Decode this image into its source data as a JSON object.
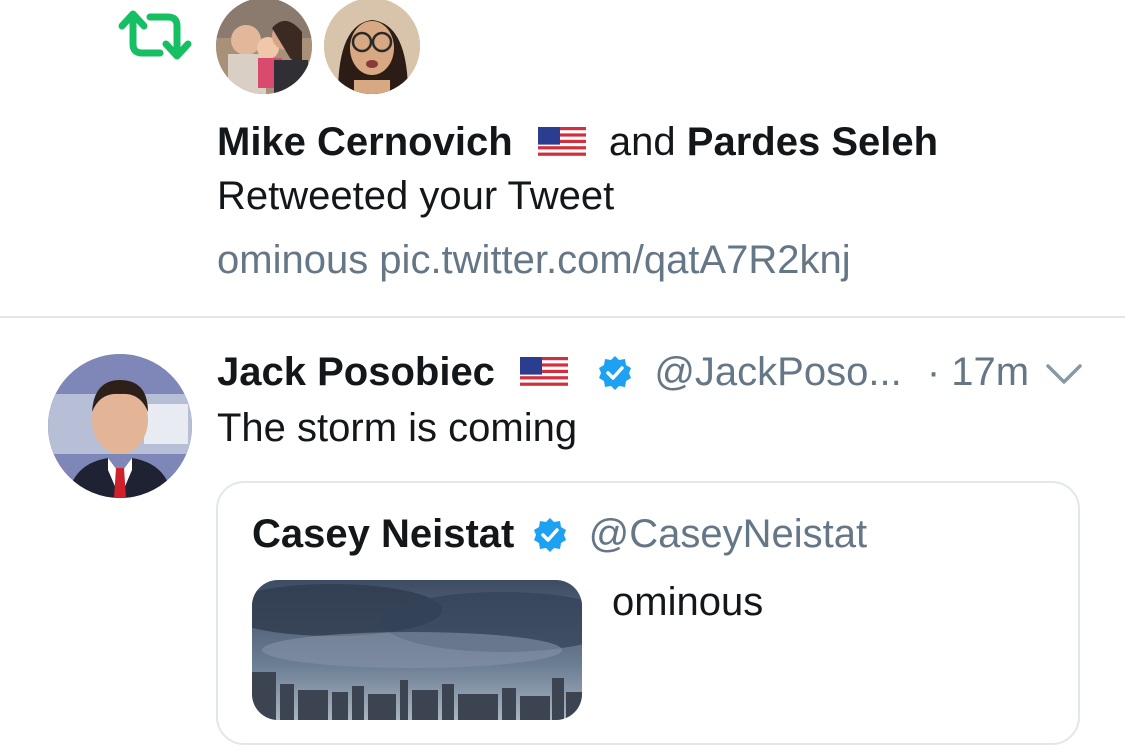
{
  "notification": {
    "user1": "Mike Cernovich",
    "connector": "and",
    "user2": "Pardes Seleh",
    "action": "Retweeted your Tweet",
    "preview": "ominous pic.twitter.com/qatA7R2knj"
  },
  "tweet": {
    "name": "Jack Posobiec",
    "handle": "@JackPoso...",
    "time": "· 17m",
    "text": "The storm is coming"
  },
  "quote": {
    "name": "Casey Neistat",
    "handle": "@CaseyNeistat",
    "text": "ominous"
  },
  "colors": {
    "retweet": "#17bf63",
    "verified": "#1da1f2",
    "secondary": "#657786"
  }
}
